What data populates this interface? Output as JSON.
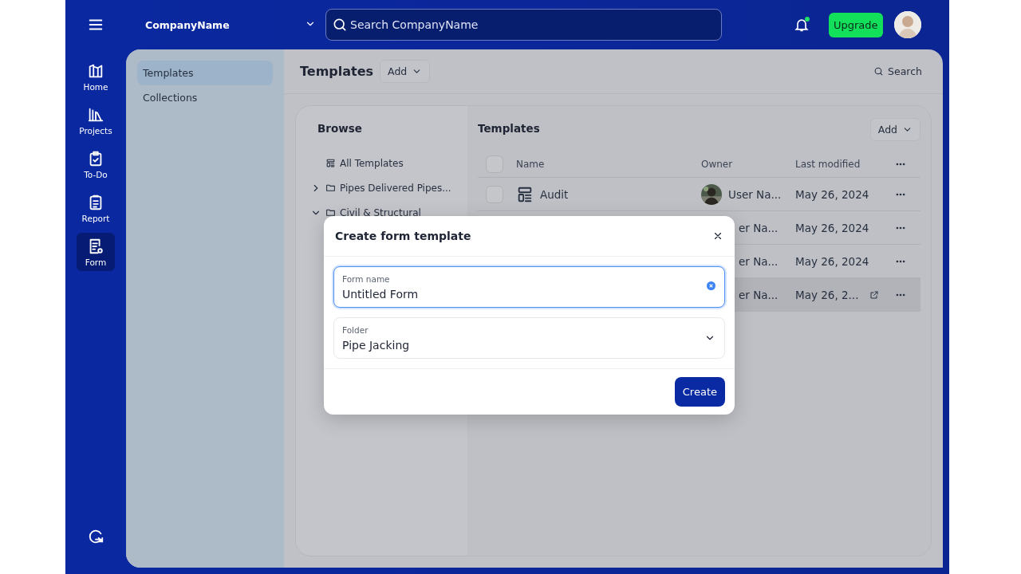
{
  "header": {
    "company": "CompanyName",
    "search": {
      "placeholder": "Search CompanyName"
    },
    "notification": true,
    "upgrade": "Upgrade"
  },
  "rail": [
    {
      "label": "Home",
      "selected": false
    },
    {
      "label": "Projects",
      "selected": false
    },
    {
      "label": "To-Do",
      "selected": false
    },
    {
      "label": "Report",
      "selected": false
    },
    {
      "label": "Form",
      "selected": true
    }
  ],
  "subnav": [
    {
      "label": "Templates",
      "selected": true
    },
    {
      "label": "Collections",
      "selected": false
    }
  ],
  "page": {
    "title": "Templates",
    "add": "Add",
    "search": "Search"
  },
  "browse": {
    "title": "Browse",
    "items": [
      {
        "label": "All Templates",
        "kind": "all"
      },
      {
        "label": "Pipes Delivered Pipes...",
        "kind": "folder",
        "expanded": false
      },
      {
        "label": "Civil & Structural",
        "kind": "folder",
        "expanded": true
      }
    ]
  },
  "templates": {
    "title": "Templates",
    "add": "Add",
    "columns": [
      "Name",
      "Owner",
      "Last modified"
    ],
    "select_all": {
      "checked": false
    },
    "rows": [
      {
        "name": "Audit",
        "checked": false,
        "owner": "User Na...",
        "modified": "May 26, 2024",
        "selected": false
      },
      {
        "owner": "er Na...",
        "modified": "May 26, 2024",
        "selected": false
      },
      {
        "owner": "er Na...",
        "modified": "May 26, 2024",
        "selected": false
      },
      {
        "owner": "er Na...",
        "modified": "May 26, 2...",
        "selected": true
      }
    ]
  },
  "dialog": {
    "title": "Create form template",
    "fields": [
      {
        "label": "Form name",
        "value": "Untitled Form",
        "kind": "text",
        "focused": true
      },
      {
        "label": "Folder",
        "value": "Pipe Jacking",
        "kind": "select",
        "focused": false
      }
    ],
    "button": "Create"
  }
}
